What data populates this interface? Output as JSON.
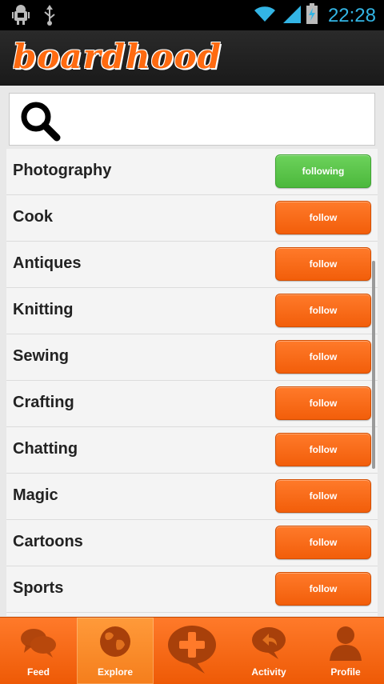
{
  "status_bar": {
    "time": "22:28"
  },
  "app": {
    "logo_text": "boardhood"
  },
  "search": {
    "placeholder": ""
  },
  "topics": [
    {
      "name": "Photography",
      "button": "following",
      "state": "following"
    },
    {
      "name": "Cook",
      "button": "follow",
      "state": "follow"
    },
    {
      "name": "Antiques",
      "button": "follow",
      "state": "follow"
    },
    {
      "name": "Knitting",
      "button": "follow",
      "state": "follow"
    },
    {
      "name": "Sewing",
      "button": "follow",
      "state": "follow"
    },
    {
      "name": "Crafting",
      "button": "follow",
      "state": "follow"
    },
    {
      "name": "Chatting",
      "button": "follow",
      "state": "follow"
    },
    {
      "name": "Magic",
      "button": "follow",
      "state": "follow"
    },
    {
      "name": "Cartoons",
      "button": "follow",
      "state": "follow"
    },
    {
      "name": "Sports",
      "button": "follow",
      "state": "follow"
    }
  ],
  "nav": [
    {
      "label": "Feed",
      "icon": "speech-bubbles-icon"
    },
    {
      "label": "Explore",
      "icon": "globe-icon",
      "active": true
    },
    {
      "label": "",
      "icon": "add-post-icon"
    },
    {
      "label": "Activity",
      "icon": "reply-bubble-icon"
    },
    {
      "label": "Profile",
      "icon": "person-icon"
    }
  ],
  "colors": {
    "accent": "#f25e0a",
    "following": "#4cb83c",
    "status": "#33b5e5"
  }
}
